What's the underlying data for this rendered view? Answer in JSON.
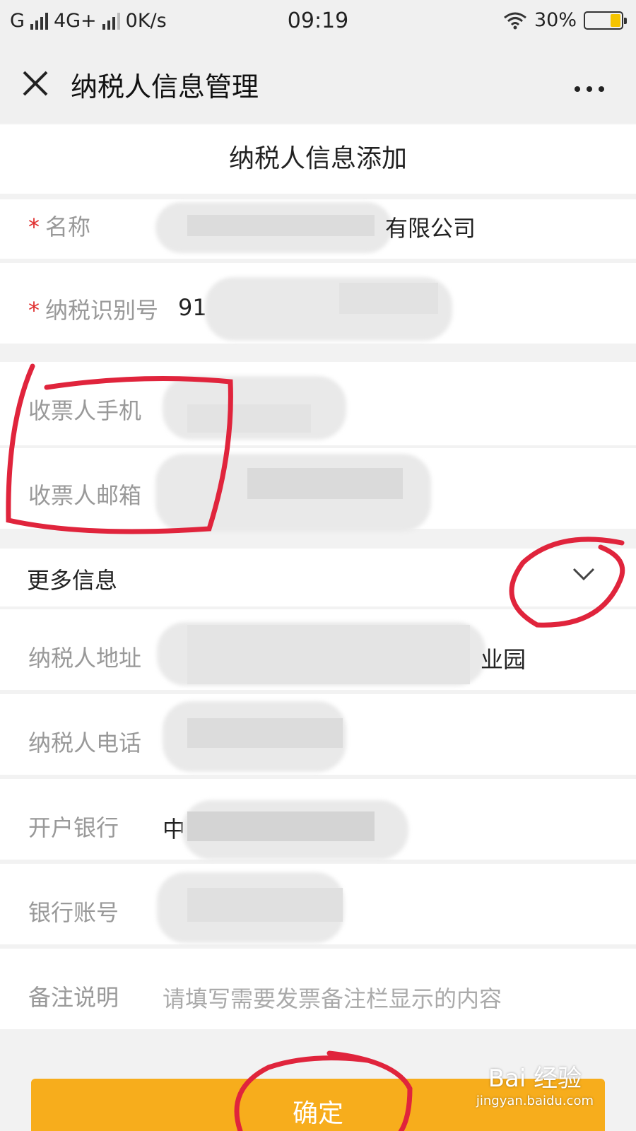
{
  "status_bar": {
    "carrier1": "G",
    "network": "4G+",
    "speed": "0K/s",
    "time": "09:19",
    "battery_percent": 30,
    "battery_label": "30%"
  },
  "nav": {
    "title": "纳税人信息管理",
    "more": "..."
  },
  "page": {
    "title": "纳税人信息添加"
  },
  "form": {
    "name": {
      "required_mark": "*",
      "label": "名称",
      "value_visible": "有限公司"
    },
    "tax_id": {
      "required_mark": "*",
      "label": "纳税识别号",
      "value_visible": "91"
    },
    "receiver_phone": {
      "label": "收票人手机"
    },
    "receiver_email": {
      "label": "收票人邮箱"
    },
    "more_info": {
      "label": "更多信息"
    },
    "address": {
      "label": "纳税人地址",
      "value_visible": "业园"
    },
    "phone": {
      "label": "纳税人电话"
    },
    "bank": {
      "label": "开户银行",
      "value_visible": "中"
    },
    "account": {
      "label": "银行账号"
    },
    "remark": {
      "label": "备注说明",
      "placeholder": "请填写需要发票备注栏显示的内容"
    }
  },
  "confirm_label": "确定",
  "watermark": {
    "brand": "Bai 经验",
    "url": "jingyan.baidu.com"
  },
  "colors": {
    "accent": "#f7ad1c",
    "required": "#e03030",
    "annotation": "#e0243c"
  }
}
